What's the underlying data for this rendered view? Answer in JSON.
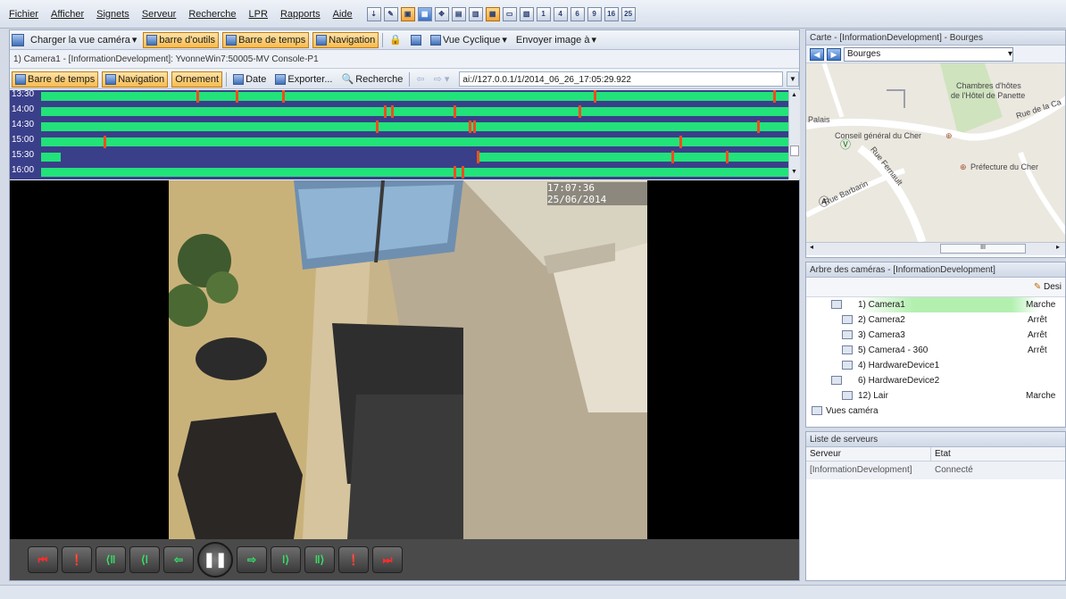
{
  "menu": {
    "items": [
      {
        "label": "Fichier"
      },
      {
        "label": "Afficher"
      },
      {
        "label": "Signets"
      },
      {
        "label": "Serveur"
      },
      {
        "label": "Recherche"
      },
      {
        "label": "LPR"
      },
      {
        "label": "Rapports"
      },
      {
        "label": "Aide"
      }
    ],
    "layout_icons": [
      "1",
      "4",
      "6",
      "9",
      "16",
      "25"
    ]
  },
  "toolbar1": {
    "load_view": "Charger la vue caméra",
    "toolbar_toggle": "barre d'outils",
    "timebar_toggle": "Barre de temps",
    "navigation_toggle": "Navigation",
    "cyclic_view": "Vue Cyclique",
    "send_image": "Envoyer image à"
  },
  "camera_caption": "1) Camera1 - [InformationDevelopment]: YvonneWin7:50005-MV Console-P1",
  "toolbar2": {
    "timebar": "Barre de temps",
    "navigation": "Navigation",
    "ornament": "Ornement",
    "date": "Date",
    "export": "Exporter...",
    "search": "Recherche",
    "url": "ai://127.0.0.1/1/2014_06_26_17:05:29.922"
  },
  "timeline": {
    "rows": [
      {
        "time": "13:30",
        "bar_start": 0.04,
        "bar_end": 1.0,
        "marks": [
          0.24,
          0.29,
          0.35,
          0.75,
          0.98
        ]
      },
      {
        "time": "14:00",
        "bar_start": 0.04,
        "bar_end": 1.0,
        "marks": [
          0.48,
          0.49,
          0.57,
          0.73
        ]
      },
      {
        "time": "14:30",
        "bar_start": 0.04,
        "bar_end": 1.0,
        "marks": [
          0.47,
          0.59,
          0.595,
          0.96
        ]
      },
      {
        "time": "15:00",
        "bar_start": 0.04,
        "bar_end": 1.0,
        "marks": [
          0.12,
          0.86
        ]
      },
      {
        "time": "15:30",
        "bar_start": 0.04,
        "bar_end": 0.065,
        "bar2_start": 0.6,
        "bar2_end": 1.0,
        "marks": [
          0.6,
          0.85,
          0.92
        ]
      },
      {
        "time": "16:00",
        "bar_start": 0.04,
        "bar_end": 1.0,
        "marks": [
          0.57,
          0.58
        ]
      }
    ]
  },
  "video": {
    "timestamp": "17:07:36 25/06/2014"
  },
  "playback_buttons": [
    {
      "name": "start-button",
      "glyph": "⏮",
      "color": "red"
    },
    {
      "name": "prev-marker-button",
      "glyph": "❗",
      "color": "orng"
    },
    {
      "name": "fast-rewind-button",
      "glyph": "⟨ǁ",
      "color": "green"
    },
    {
      "name": "step-back-button",
      "glyph": "⟨ǀ",
      "color": "green"
    },
    {
      "name": "rewind-button",
      "glyph": "⇦",
      "color": "green"
    },
    {
      "name": "pause-button",
      "glyph": "❚❚",
      "color": "pause"
    },
    {
      "name": "play-button",
      "glyph": "⇨",
      "color": "green"
    },
    {
      "name": "step-forward-button",
      "glyph": "ǀ⟩",
      "color": "green"
    },
    {
      "name": "fast-forward-button",
      "glyph": "ǁ⟩",
      "color": "green"
    },
    {
      "name": "next-marker-button",
      "glyph": "❗",
      "color": "orng"
    },
    {
      "name": "end-button",
      "glyph": "⏭",
      "color": "red"
    }
  ],
  "map_pane": {
    "title": "Carte - [InformationDevelopment] - Bourges",
    "city": "Bourges",
    "labels": {
      "hotel": "Chambres d'hôtes",
      "hotel2": "de l'Hôtel de Panette",
      "rue_calvin": "Rue de la Ca",
      "palais": "Palais",
      "conseil": "Conseil général du Cher",
      "rue_fernault": "Rue Fernault",
      "prefecture": "Préfecture du Cher",
      "rue_barbarin": "Rue Barbarin",
      "scroll_thumb": "III"
    }
  },
  "tree_pane": {
    "title": "Arbre des caméras - [InformationDevelopment]",
    "design": "Desi",
    "items": [
      {
        "name": "1) Camera1",
        "state": "Marche"
      },
      {
        "name": "2) Camera2",
        "state": "Arrêt"
      },
      {
        "name": "3) Camera3",
        "state": "Arrêt"
      },
      {
        "name": "5) Camera4 - 360",
        "state": "Arrêt"
      },
      {
        "name": "4) HardwareDevice1",
        "state": ""
      },
      {
        "name": "6) HardwareDevice2",
        "state": ""
      },
      {
        "name": "12) Lair",
        "state": "Marche"
      },
      {
        "name": "Vues caméra",
        "state": ""
      }
    ]
  },
  "server_pane": {
    "title": "Liste de serveurs",
    "col_server": "Serveur",
    "col_state": "Etat",
    "rows": [
      {
        "server": "[InformationDevelopment]",
        "state": "Connecté"
      }
    ]
  },
  "colors": {
    "timeline_bg": "#3a3f8a",
    "timeline_bar": "#22e27a",
    "timeline_mark": "#f24c1e",
    "active_orange": "#f6bb4f"
  }
}
